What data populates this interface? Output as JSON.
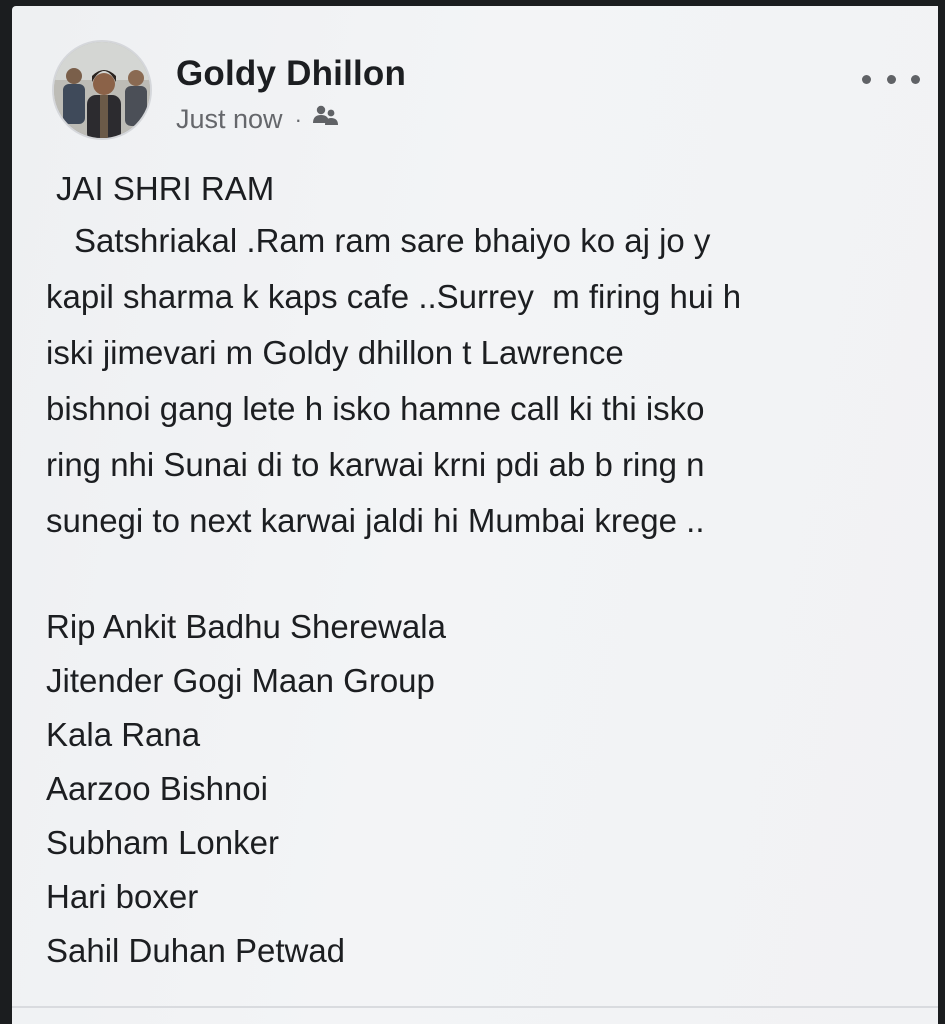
{
  "post": {
    "author": "Goldy Dhillon",
    "timestamp": "Just now",
    "separator": "·",
    "audience_icon": "friends-icon",
    "more_icon": "more-options-icon",
    "title": "JAI SHRI RAM",
    "body_lines": [
      "Satshriakal .Ram ram sare bhaiyo ko aj jo y",
      "kapil sharma k kaps cafe ..Surrey  m firing hui h",
      "iski jimevari m Goldy dhillon t Lawrence",
      "bishnoi gang lete h isko hamne call ki thi isko",
      "ring nhi Sunai di to karwai krni pdi ab b ring n",
      "sunegi to next karwai jaldi hi Mumbai krege .."
    ],
    "list_lines": [
      "Rip Ankit Badhu Sherewala",
      "Jitender Gogi Maan Group",
      "Kala Rana",
      "Aarzoo Bishnoi",
      "Subham Lonker",
      "Hari boxer",
      "Sahil Duhan Petwad"
    ]
  },
  "colors": {
    "background": "#f1f2f4",
    "text": "#1c1e21",
    "secondary_text": "#65676b"
  }
}
